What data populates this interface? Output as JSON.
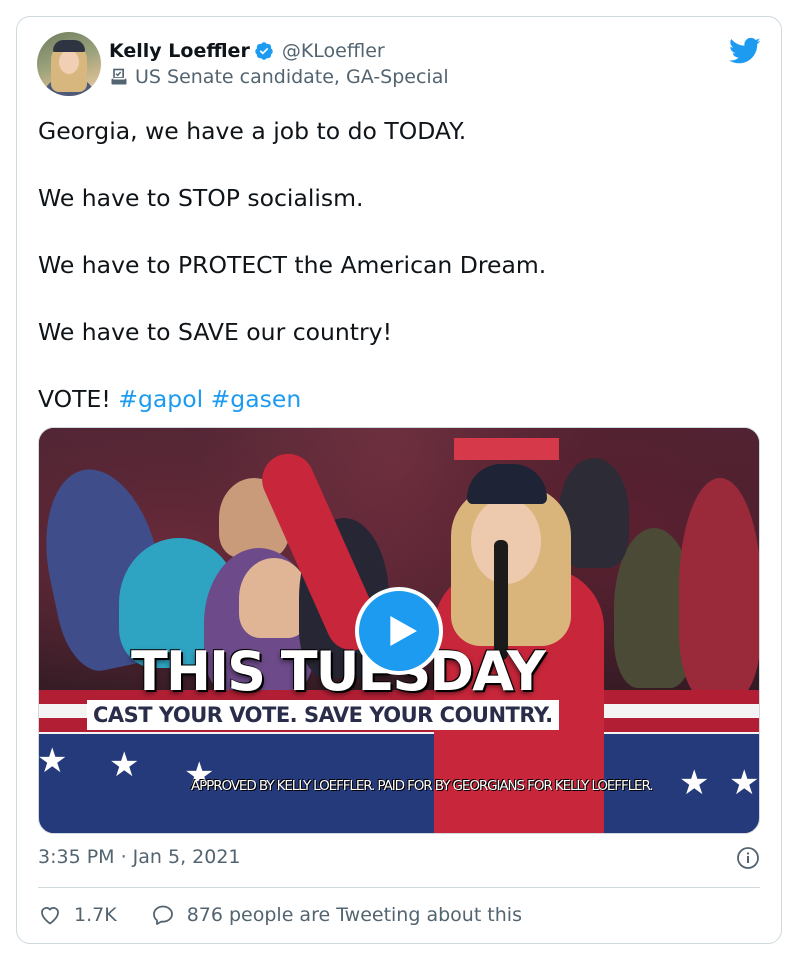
{
  "author": {
    "display_name": "Kelly Loeffler",
    "handle": "@KLoeffler",
    "label": "US Senate candidate, GA-Special",
    "verified": true,
    "label_icon": "ballot-box-icon"
  },
  "tweet": {
    "paragraphs": [
      "Georgia, we have a job to do TODAY.",
      "We have to STOP socialism.",
      "We have to PROTECT the American Dream.",
      "We have to SAVE our country!"
    ],
    "last_line_prefix": "VOTE!",
    "hashtags": [
      "#gapol",
      "#gasen"
    ]
  },
  "media": {
    "overlay_title": "THIS TUESDAY",
    "overlay_subtitle": "CAST YOUR VOTE. SAVE YOUR COUNTRY.",
    "disclaimer": "APPROVED BY KELLY LOEFFLER. PAID FOR BY GEORGIANS FOR KELLY LOEFFLER.",
    "play_icon": "play-icon"
  },
  "meta": {
    "timestamp": "3:35 PM · Jan 5, 2021"
  },
  "engagement": {
    "likes": "1.7K",
    "conversation": "876 people are Tweeting about this"
  },
  "colors": {
    "accent": "#1d9bf0",
    "text": "#0f1419",
    "secondary": "#536471",
    "border": "#cfd9de"
  }
}
